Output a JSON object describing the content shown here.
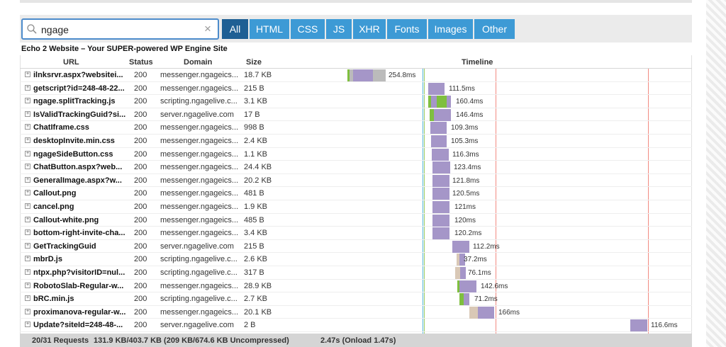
{
  "search": {
    "value": "ngage",
    "placeholder": ""
  },
  "filters": [
    "All",
    "HTML",
    "CSS",
    "JS",
    "XHR",
    "Fonts",
    "Images",
    "Other"
  ],
  "active_filter": "All",
  "site_title": "Echo 2 Website – Your SUPER-powered WP Engine Site",
  "columns": {
    "url": "URL",
    "status": "Status",
    "domain": "Domain",
    "size": "Size",
    "timeline": "Timeline"
  },
  "rows": [
    {
      "url": "ilnksrvr.aspx?websitei...",
      "status": "200",
      "domain": "messenger.ngageics...",
      "size": "18.7 KB",
      "time": "254.8ms"
    },
    {
      "url": "getscript?id=248-48-22...",
      "status": "200",
      "domain": "messenger.ngageics...",
      "size": "215 B",
      "time": "111.5ms"
    },
    {
      "url": "ngage.splitTracking.js",
      "status": "200",
      "domain": "scripting.ngagelive.c...",
      "size": "3.1 KB",
      "time": "160.4ms"
    },
    {
      "url": "IsValidTrackingGuid?si...",
      "status": "200",
      "domain": "server.ngagelive.com",
      "size": "17 B",
      "time": "146.4ms"
    },
    {
      "url": "ChatIframe.css",
      "status": "200",
      "domain": "messenger.ngageics...",
      "size": "998 B",
      "time": "109.3ms"
    },
    {
      "url": "desktopInvite.min.css",
      "status": "200",
      "domain": "messenger.ngageics...",
      "size": "2.4 KB",
      "time": "105.3ms"
    },
    {
      "url": "ngageSideButton.css",
      "status": "200",
      "domain": "messenger.ngageics...",
      "size": "1.1 KB",
      "time": "116.3ms"
    },
    {
      "url": "ChatButton.aspx?web...",
      "status": "200",
      "domain": "messenger.ngageics...",
      "size": "24.4 KB",
      "time": "123.4ms"
    },
    {
      "url": "GeneralImage.aspx?w...",
      "status": "200",
      "domain": "messenger.ngageics...",
      "size": "20.2 KB",
      "time": "121.8ms"
    },
    {
      "url": "Callout.png",
      "status": "200",
      "domain": "messenger.ngageics...",
      "size": "481 B",
      "time": "120.5ms"
    },
    {
      "url": "cancel.png",
      "status": "200",
      "domain": "messenger.ngageics...",
      "size": "1.9 KB",
      "time": "121ms"
    },
    {
      "url": "Callout-white.png",
      "status": "200",
      "domain": "messenger.ngageics...",
      "size": "485 B",
      "time": "120ms"
    },
    {
      "url": "bottom-right-invite-cha...",
      "status": "200",
      "domain": "messenger.ngageics...",
      "size": "3.4 KB",
      "time": "120.2ms"
    },
    {
      "url": "GetTrackingGuid",
      "status": "200",
      "domain": "server.ngagelive.com",
      "size": "215 B",
      "time": "112.2ms"
    },
    {
      "url": "mbrD.js",
      "status": "200",
      "domain": "scripting.ngagelive.c...",
      "size": "2.6 KB",
      "time": "37.2ms"
    },
    {
      "url": "ntpx.php?visitorID=nul...",
      "status": "200",
      "domain": "scripting.ngagelive.c...",
      "size": "317 B",
      "time": "76.1ms"
    },
    {
      "url": "RobotoSlab-Regular-w...",
      "status": "200",
      "domain": "messenger.ngageics...",
      "size": "28.9 KB",
      "time": "142.6ms"
    },
    {
      "url": "bRC.min.js",
      "status": "200",
      "domain": "scripting.ngagelive.c...",
      "size": "2.7 KB",
      "time": "71.2ms"
    },
    {
      "url": "proximanova-regular-w...",
      "status": "200",
      "domain": "messenger.ngageics...",
      "size": "20.1 KB",
      "time": "166ms"
    },
    {
      "url": "Update?siteId=248-48-...",
      "status": "200",
      "domain": "server.ngagelive.com",
      "size": "2 B",
      "time": "116.6ms"
    }
  ],
  "footer": {
    "requests": "20/31 Requests",
    "transfer": "131.9 KB/403.7 KB  (209 KB/674.6 KB Uncompressed)",
    "load": "2.47s  (Onload 1.47s)"
  },
  "colors": {
    "active_filter": "#1e5f94",
    "filter": "#3d9ad5",
    "search_border": "#4c8bcb",
    "bar_receive": "#a596c8",
    "bar_wait": "#7fbf3f",
    "bar_block": "#d9c8b6",
    "bar_gray": "#bbbbbb"
  }
}
